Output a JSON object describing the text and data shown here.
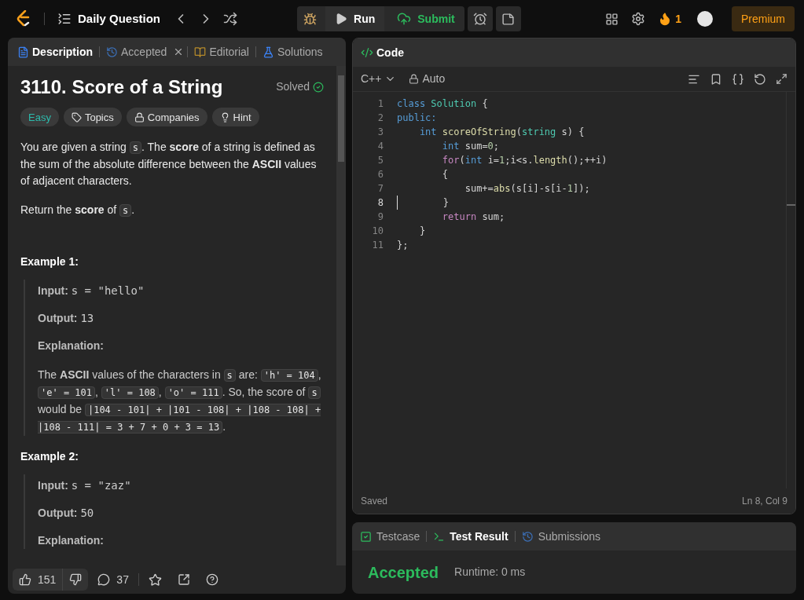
{
  "topbar": {
    "title": "Daily Question",
    "run": "Run",
    "submit": "Submit",
    "streak": "1",
    "premium": "Premium"
  },
  "left_tabs": [
    {
      "label": "Description",
      "selected": true,
      "closable": false
    },
    {
      "label": "Accepted",
      "selected": false,
      "closable": true
    },
    {
      "label": "Editorial",
      "selected": false,
      "closable": false
    },
    {
      "label": "Solutions",
      "selected": false,
      "closable": false
    }
  ],
  "problem": {
    "title": "3110. Score of a String",
    "status": "Solved",
    "difficulty": "Easy",
    "chips": [
      {
        "label": "Topics"
      },
      {
        "label": "Companies"
      },
      {
        "label": "Hint"
      }
    ],
    "paragraphs": [
      [
        {
          "kind": "text",
          "text": "You are given a string "
        },
        {
          "kind": "code",
          "text": "s"
        },
        {
          "kind": "text",
          "text": ". The **score** of a string is defined as the sum of the absolute difference between the **ASCII** values of adjacent characters."
        }
      ],
      [
        {
          "kind": "text",
          "text": "Return the **score** of "
        },
        {
          "kind": "code",
          "text": "s"
        },
        {
          "kind": "text",
          "text": "."
        }
      ]
    ],
    "examples": [
      {
        "heading": "Example 1:",
        "input_label": "Input:",
        "input": "s = \"hello\"",
        "output_label": "Output:",
        "output": "13",
        "explanation_label": "Explanation:",
        "explanation": [
          {
            "kind": "text",
            "text": "The **ASCII** values of the characters in "
          },
          {
            "kind": "code",
            "text": "s"
          },
          {
            "kind": "text",
            "text": " are: "
          },
          {
            "kind": "code",
            "text": "'h' = 104"
          },
          {
            "kind": "text",
            "text": ", "
          },
          {
            "kind": "code",
            "text": "'e' = 101"
          },
          {
            "kind": "text",
            "text": ", "
          },
          {
            "kind": "code",
            "text": "'l' = 108"
          },
          {
            "kind": "text",
            "text": ", "
          },
          {
            "kind": "code",
            "text": "'o' = 111"
          },
          {
            "kind": "text",
            "text": ". So, the score of "
          },
          {
            "kind": "code",
            "text": "s"
          },
          {
            "kind": "text",
            "text": " would be "
          },
          {
            "kind": "code",
            "text": "|104 - 101| + |101 - 108| + |108 - 108| + |108 - 111| = 3 + 7 + 0 + 3 = 13"
          },
          {
            "kind": "text",
            "text": "."
          }
        ]
      },
      {
        "heading": "Example 2:",
        "input_label": "Input:",
        "input": "s = \"zaz\"",
        "output_label": "Output:",
        "output": "50",
        "explanation_label": "Explanation:"
      }
    ]
  },
  "footer": {
    "likes": "151",
    "comments": "37"
  },
  "code_panel": {
    "title": "Code",
    "language": "C++",
    "mode": "Auto",
    "status": "Saved",
    "position": "Ln 8, Col 9",
    "lines": [
      {
        "number": "1",
        "current": false,
        "tokens": [
          {
            "kind": "keyword",
            "text": "class "
          },
          {
            "kind": "type",
            "text": "Solution"
          },
          {
            "kind": "plain",
            "text": " {"
          }
        ]
      },
      {
        "number": "2",
        "current": false,
        "tokens": [
          {
            "kind": "keyword",
            "text": "public:"
          }
        ]
      },
      {
        "number": "3",
        "current": false,
        "tokens": [
          {
            "kind": "keyword",
            "text": "    int "
          },
          {
            "kind": "func",
            "text": "scoreOfString"
          },
          {
            "kind": "plain",
            "text": "("
          },
          {
            "kind": "type",
            "text": "string"
          },
          {
            "kind": "plain",
            "text": " s) {"
          }
        ]
      },
      {
        "number": "4",
        "current": false,
        "tokens": [
          {
            "kind": "keyword",
            "text": "        int "
          },
          {
            "kind": "plain",
            "text": "sum="
          },
          {
            "kind": "number",
            "text": "0"
          },
          {
            "kind": "plain",
            "text": ";"
          }
        ]
      },
      {
        "number": "5",
        "current": false,
        "tokens": [
          {
            "kind": "control",
            "text": "        for"
          },
          {
            "kind": "plain",
            "text": "("
          },
          {
            "kind": "keyword",
            "text": "int "
          },
          {
            "kind": "plain",
            "text": "i="
          },
          {
            "kind": "number",
            "text": "1"
          },
          {
            "kind": "plain",
            "text": ";i<s."
          },
          {
            "kind": "func",
            "text": "length"
          },
          {
            "kind": "plain",
            "text": "();++i)"
          }
        ]
      },
      {
        "number": "6",
        "current": false,
        "tokens": [
          {
            "kind": "plain",
            "text": "        {"
          }
        ]
      },
      {
        "number": "7",
        "current": false,
        "tokens": [
          {
            "kind": "plain",
            "text": "            sum+="
          },
          {
            "kind": "func",
            "text": "abs"
          },
          {
            "kind": "plain",
            "text": "(s[i]-s[i-"
          },
          {
            "kind": "number",
            "text": "1"
          },
          {
            "kind": "plain",
            "text": "]);"
          }
        ]
      },
      {
        "number": "8",
        "current": true,
        "tokens": [
          {
            "kind": "plain",
            "text": "        }"
          }
        ]
      },
      {
        "number": "9",
        "current": false,
        "tokens": [
          {
            "kind": "control",
            "text": "        return "
          },
          {
            "kind": "plain",
            "text": "sum;"
          }
        ]
      },
      {
        "number": "10",
        "current": false,
        "tokens": [
          {
            "kind": "plain",
            "text": "    }"
          }
        ]
      },
      {
        "number": "11",
        "current": false,
        "tokens": [
          {
            "kind": "plain",
            "text": "};"
          }
        ]
      }
    ]
  },
  "bottom_tabs": [
    {
      "label": "Testcase",
      "selected": false
    },
    {
      "label": "Test Result",
      "selected": true
    },
    {
      "label": "Submissions",
      "selected": false
    }
  ],
  "result": {
    "verdict": "Accepted",
    "runtime": "Runtime: 0 ms"
  }
}
